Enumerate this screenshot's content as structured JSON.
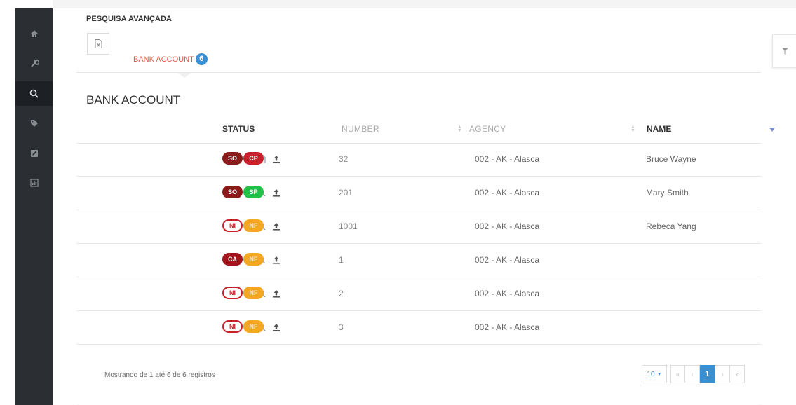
{
  "sidebar": {
    "items": [
      {
        "icon": "home-icon",
        "active": false
      },
      {
        "icon": "wrench-icon",
        "active": false
      },
      {
        "icon": "search-icon",
        "active": true
      },
      {
        "icon": "tag-icon",
        "active": false
      },
      {
        "icon": "edit-icon",
        "active": false
      },
      {
        "icon": "report-icon",
        "active": false
      }
    ]
  },
  "header": {
    "section_title": "PESQUISA AVANÇADA",
    "export_icon": "excel-icon",
    "tab_label": "BANK ACCOUNT",
    "tab_count": "6"
  },
  "panel": {
    "title": "BANK ACCOUNT"
  },
  "table": {
    "columns": {
      "status": "STATUS",
      "number": "NUMBER",
      "agency": "AGENCY",
      "name": "NAME"
    },
    "rows": [
      {
        "has_doc": true,
        "badges": [
          {
            "text": "SO",
            "style": "so"
          },
          {
            "text": "CP",
            "style": "cp"
          }
        ],
        "number": "32",
        "agency": "002 - AK - Alasca",
        "name": "Bruce Wayne"
      },
      {
        "has_doc": false,
        "badges": [
          {
            "text": "SO",
            "style": "so"
          },
          {
            "text": "SP",
            "style": "sp"
          }
        ],
        "number": "201",
        "agency": "002 - AK - Alasca",
        "name": "Mary Smith"
      },
      {
        "has_doc": false,
        "badges": [
          {
            "text": "NI",
            "style": "ni"
          },
          {
            "text": "NF",
            "style": "nf"
          }
        ],
        "number": "1001",
        "agency": "002 - AK - Alasca",
        "name": "Rebeca Yang"
      },
      {
        "has_doc": false,
        "badges": [
          {
            "text": "CA",
            "style": "ca"
          },
          {
            "text": "NF",
            "style": "nf"
          }
        ],
        "number": "1",
        "agency": "002 - AK - Alasca",
        "name": ""
      },
      {
        "has_doc": false,
        "badges": [
          {
            "text": "NI",
            "style": "ni"
          },
          {
            "text": "NF",
            "style": "nf"
          }
        ],
        "number": "2",
        "agency": "002 - AK - Alasca",
        "name": ""
      },
      {
        "has_doc": false,
        "badges": [
          {
            "text": "NI",
            "style": "ni"
          },
          {
            "text": "NF",
            "style": "nf"
          }
        ],
        "number": "3",
        "agency": "002 - AK - Alasca",
        "name": ""
      }
    ]
  },
  "footer": {
    "info": "Mostrando de 1 até 6 de 6 registros",
    "page_size": "10",
    "current_page": "1"
  },
  "colors": {
    "sidebar_bg": "#2b2f33",
    "tab_accent": "#e05a4a",
    "badge_blue": "#3a8fd1",
    "status_dark_red": "#8b1a1a",
    "status_red": "#c8202a",
    "status_green": "#22c24a",
    "status_orange": "#f5a623"
  }
}
